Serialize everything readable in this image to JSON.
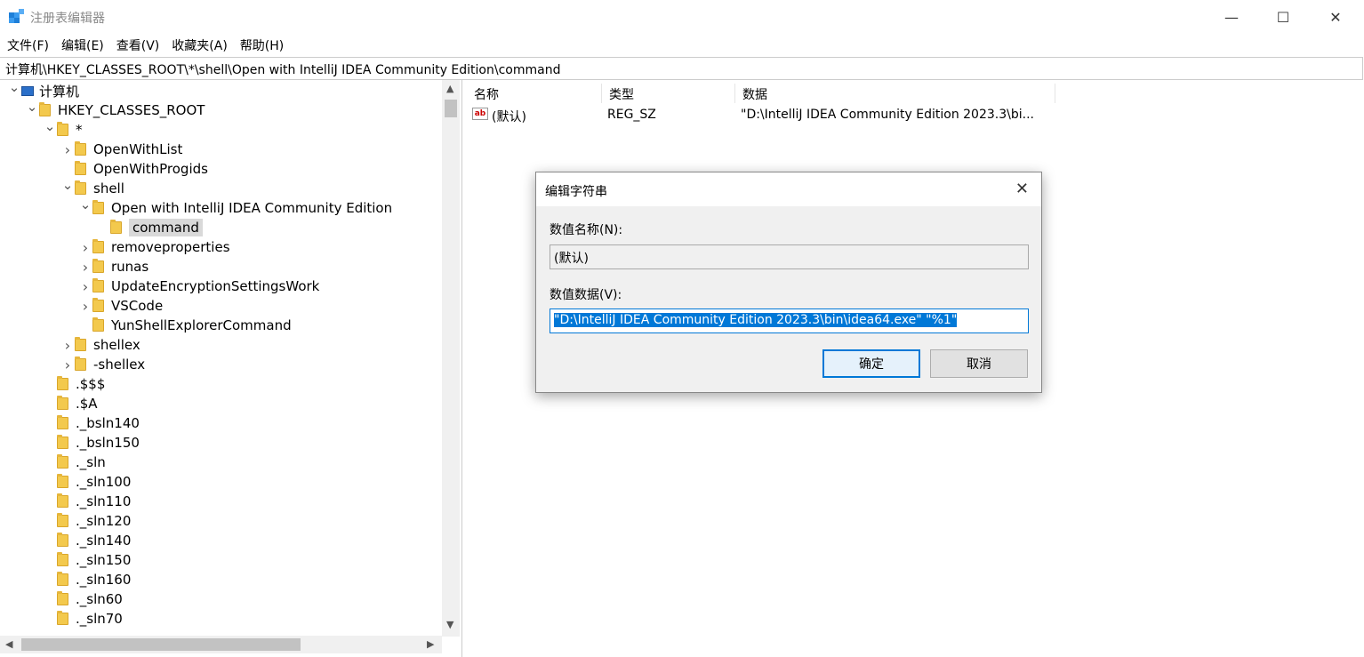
{
  "window": {
    "title": "注册表编辑器",
    "controls": {
      "minimize": "—",
      "maximize": "☐",
      "close": "✕"
    }
  },
  "menu": [
    "文件(F)",
    "编辑(E)",
    "查看(V)",
    "收藏夹(A)",
    "帮助(H)"
  ],
  "address": "计算机\\HKEY_CLASSES_ROOT\\*\\shell\\Open with IntelliJ IDEA Community Edition\\command",
  "tree": [
    {
      "label": "计算机",
      "depth": 0,
      "chevron": "down",
      "icon": "computer"
    },
    {
      "label": "HKEY_CLASSES_ROOT",
      "depth": 1,
      "chevron": "down",
      "icon": "folder"
    },
    {
      "label": "*",
      "depth": 2,
      "chevron": "down",
      "icon": "folder"
    },
    {
      "label": "OpenWithList",
      "depth": 3,
      "chevron": "right",
      "icon": "folder"
    },
    {
      "label": "OpenWithProgids",
      "depth": 3,
      "chevron": "none",
      "icon": "folder"
    },
    {
      "label": "shell",
      "depth": 3,
      "chevron": "down",
      "icon": "folder"
    },
    {
      "label": "Open with IntelliJ IDEA Community Edition",
      "depth": 4,
      "chevron": "down",
      "icon": "folder"
    },
    {
      "label": "command",
      "depth": 5,
      "chevron": "none",
      "icon": "folder",
      "selected": true
    },
    {
      "label": "removeproperties",
      "depth": 4,
      "chevron": "right",
      "icon": "folder"
    },
    {
      "label": "runas",
      "depth": 4,
      "chevron": "right",
      "icon": "folder"
    },
    {
      "label": "UpdateEncryptionSettingsWork",
      "depth": 4,
      "chevron": "right",
      "icon": "folder"
    },
    {
      "label": "VSCode",
      "depth": 4,
      "chevron": "right",
      "icon": "folder"
    },
    {
      "label": "YunShellExplorerCommand",
      "depth": 4,
      "chevron": "none",
      "icon": "folder"
    },
    {
      "label": "shellex",
      "depth": 3,
      "chevron": "right",
      "icon": "folder"
    },
    {
      "label": "-shellex",
      "depth": 3,
      "chevron": "right",
      "icon": "folder"
    },
    {
      "label": ".$$$",
      "depth": 2,
      "chevron": "none",
      "icon": "folder"
    },
    {
      "label": ".$A",
      "depth": 2,
      "chevron": "none",
      "icon": "folder"
    },
    {
      "label": "._bsln140",
      "depth": 2,
      "chevron": "none",
      "icon": "folder"
    },
    {
      "label": "._bsln150",
      "depth": 2,
      "chevron": "none",
      "icon": "folder"
    },
    {
      "label": "._sln",
      "depth": 2,
      "chevron": "none",
      "icon": "folder"
    },
    {
      "label": "._sln100",
      "depth": 2,
      "chevron": "none",
      "icon": "folder"
    },
    {
      "label": "._sln110",
      "depth": 2,
      "chevron": "none",
      "icon": "folder"
    },
    {
      "label": "._sln120",
      "depth": 2,
      "chevron": "none",
      "icon": "folder"
    },
    {
      "label": "._sln140",
      "depth": 2,
      "chevron": "none",
      "icon": "folder"
    },
    {
      "label": "._sln150",
      "depth": 2,
      "chevron": "none",
      "icon": "folder"
    },
    {
      "label": "._sln160",
      "depth": 2,
      "chevron": "none",
      "icon": "folder"
    },
    {
      "label": "._sln60",
      "depth": 2,
      "chevron": "none",
      "icon": "folder"
    },
    {
      "label": "._sln70",
      "depth": 2,
      "chevron": "none",
      "icon": "folder"
    }
  ],
  "list": {
    "columns": {
      "name": "名称",
      "type": "类型",
      "data": "数据"
    },
    "rows": [
      {
        "icon": "ab",
        "name": "(默认)",
        "type": "REG_SZ",
        "data": "\"D:\\IntelliJ IDEA Community Edition 2023.3\\bi..."
      }
    ]
  },
  "dialog": {
    "title": "编辑字符串",
    "name_label": "数值名称(N):",
    "name_value": "(默认)",
    "data_label": "数值数据(V):",
    "data_value": "\"D:\\IntelliJ IDEA Community Edition 2023.3\\bin\\idea64.exe\" \"%1\"",
    "ok": "确定",
    "cancel": "取消"
  }
}
